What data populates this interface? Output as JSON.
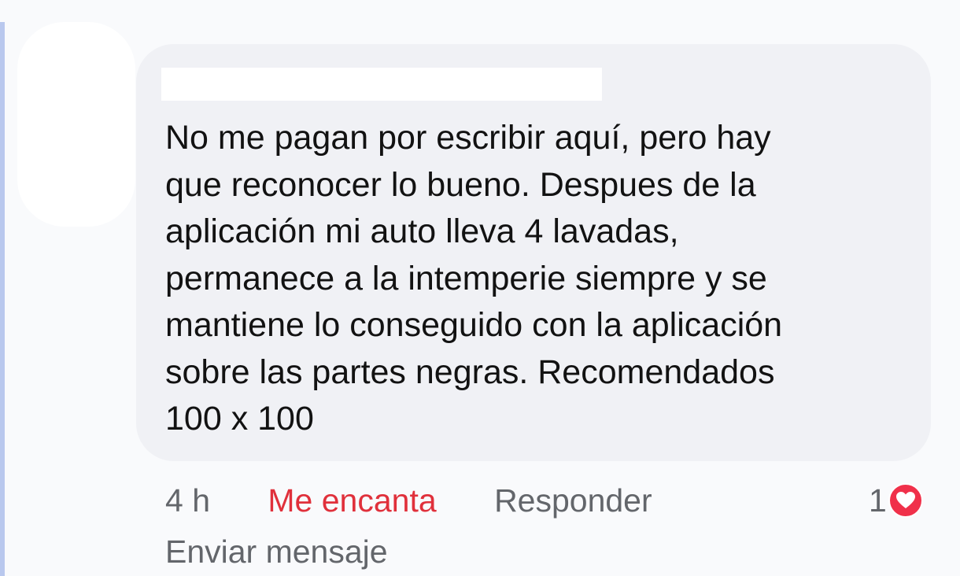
{
  "comment": {
    "author": "",
    "text": "No me pagan por escribir aquí, pero hay\nque reconocer lo bueno. Despues de la\naplicación mi auto lleva 4 lavadas,\npermanece a la intemperie siempre y se\nmantiene lo conseguido con la aplicación\nsobre las partes negras. Recomendados\n100 x 100"
  },
  "actions": {
    "time": "4 h",
    "love_label": "Me encanta",
    "reply_label": "Responder",
    "send_message_label": "Enviar mensaje"
  },
  "reactions": {
    "count": "1",
    "icon": "heart-icon",
    "color": "#f0304a"
  },
  "colors": {
    "love_active": "#e0303b",
    "bubble": "#f0f1f5",
    "thread_line": "#b9c8ee",
    "meta_text": "#63666b"
  }
}
